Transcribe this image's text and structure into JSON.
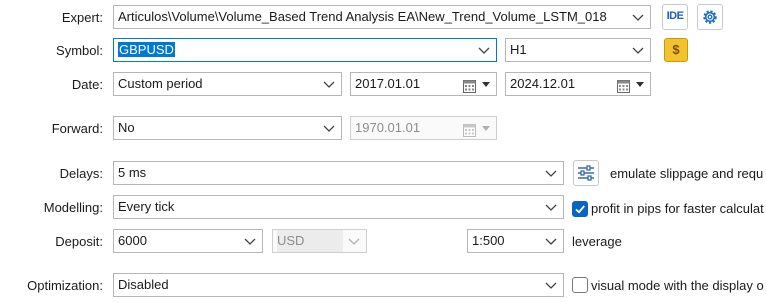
{
  "expert": {
    "label": "Expert:",
    "value": "Articulos\\Volume\\Volume_Based Trend Analysis EA\\New_Trend_Volume_LSTM_018",
    "ide_label": "IDE"
  },
  "symbol": {
    "label": "Symbol:",
    "value": "GBPUSD",
    "timeframe": "H1",
    "currency_glyph": "$"
  },
  "date": {
    "label": "Date:",
    "period": "Custom period",
    "start": "2017.01.01",
    "end": "2024.12.01"
  },
  "forward": {
    "label": "Forward:",
    "value": "No",
    "date": "1970.01.01"
  },
  "delays": {
    "label": "Delays:",
    "value": "5 ms",
    "side_text": "emulate slippage and requ"
  },
  "modelling": {
    "label": "Modelling:",
    "value": "Every tick",
    "profit_pips_checked": true,
    "profit_pips_text": "profit in pips for faster calculat"
  },
  "deposit": {
    "label": "Deposit:",
    "value": "6000",
    "currency": "USD",
    "leverage_value": "1:500",
    "leverage_text": "leverage"
  },
  "optimization": {
    "label": "Optimization:",
    "value": "Disabled",
    "visual_mode_checked": false,
    "visual_mode_text": "visual mode with the display o"
  },
  "colors": {
    "accent": "#0078d7",
    "checkbox_blue": "#0a64c2",
    "dollar_button": "#f2c230"
  }
}
